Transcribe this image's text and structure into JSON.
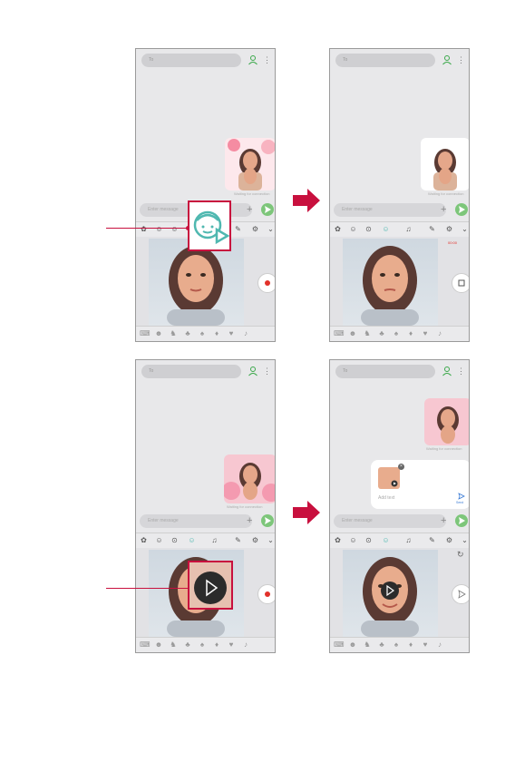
{
  "panels": [
    {
      "search_placeholder": "To",
      "sticker_caption": "Waiting for connection",
      "composer_placeholder": "Enter message"
    },
    {
      "search_placeholder": "To",
      "sticker_caption": "Waiting for connection",
      "composer_placeholder": "Enter message",
      "recording_time": "00:00"
    },
    {
      "search_placeholder": "To",
      "sticker_caption": "Waiting for connection",
      "composer_placeholder": "Enter message"
    },
    {
      "search_placeholder": "To",
      "sticker_caption": "Waiting for connection",
      "composer_placeholder": "Enter message",
      "attachment_text": "Add text",
      "send_label": "Send"
    }
  ],
  "colors": {
    "accent": "#c8103e",
    "send": "#7dc67a",
    "callout_icon": "#4fb8b0"
  },
  "icons": [
    "contact-icon",
    "more-icon",
    "plus-icon",
    "send-icon",
    "keyboard-icon",
    "emoji-icon",
    "sticker-icon",
    "ar-emoji-icon",
    "mic-icon",
    "handwriting-icon",
    "settings-icon",
    "chevron-down-icon",
    "record-icon",
    "stop-icon",
    "play-icon",
    "refresh-icon"
  ]
}
